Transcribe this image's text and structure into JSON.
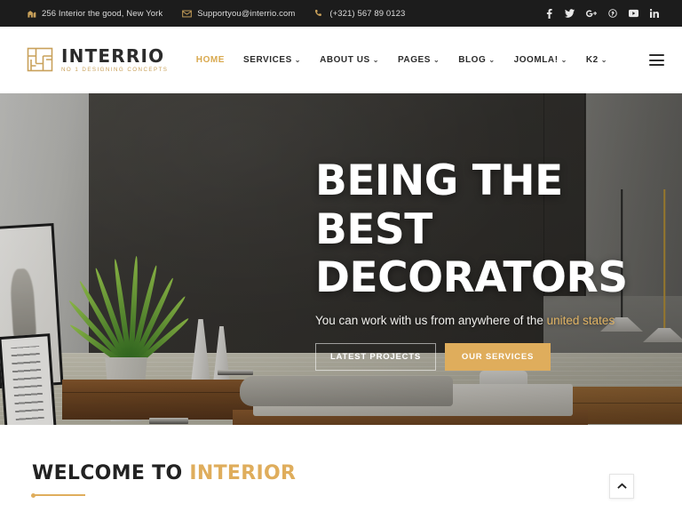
{
  "topbar": {
    "address": "256 Interior the good, New York",
    "email": "Supportyou@interrio.com",
    "phone": "(+321) 567 89 0123",
    "address_icon": "building-icon",
    "email_icon": "envelope-icon",
    "phone_icon": "phone-icon",
    "social": [
      {
        "name": "facebook-icon",
        "glyph": "f"
      },
      {
        "name": "twitter-icon",
        "glyph": "t"
      },
      {
        "name": "google-plus-icon",
        "glyph": "G+"
      },
      {
        "name": "pinterest-icon",
        "glyph": "p"
      },
      {
        "name": "youtube-icon",
        "glyph": "y"
      },
      {
        "name": "linkedin-icon",
        "glyph": "in"
      }
    ]
  },
  "header": {
    "logo_name": "INTERRIO",
    "logo_tagline": "NO 1 DESIGNING CONCEPTS",
    "logo_mark_icon": "floorplan-grid-icon",
    "menu_icon": "hamburger-menu-icon",
    "nav": [
      {
        "label": "HOME",
        "active": true,
        "caret": ""
      },
      {
        "label": "SERVICES",
        "active": false,
        "caret": "⌄"
      },
      {
        "label": "ABOUT US",
        "active": false,
        "caret": "⌄"
      },
      {
        "label": "PAGES",
        "active": false,
        "caret": "⌄"
      },
      {
        "label": "BLOG",
        "active": false,
        "caret": "⌄"
      },
      {
        "label": "JOOMLA!",
        "active": false,
        "caret": "⌄"
      },
      {
        "label": "K2",
        "active": false,
        "caret": "⌄"
      }
    ]
  },
  "hero": {
    "title_line1": "BEING THE BEST",
    "title_line2": "DECORATORS",
    "subtitle_prefix": "You can work with us from anywhere of the ",
    "subtitle_accent": "united states",
    "primary_button": "LATEST PROJECTS",
    "secondary_button": "OUR SERVICES",
    "scene_description": "Modern bedroom interior with wooden bed, potted plant, framed artwork and pendant lamps"
  },
  "welcome": {
    "title_prefix": "WELCOME TO ",
    "title_accent": "INTERIOR"
  },
  "scroll_top": {
    "icon": "chevron-up-icon"
  },
  "colors": {
    "gold": "#dfad5c",
    "gold_dark": "#c9a15a",
    "topbar_bg": "#1c1c1c",
    "text_dark": "#2c2c2c",
    "white": "#ffffff"
  }
}
